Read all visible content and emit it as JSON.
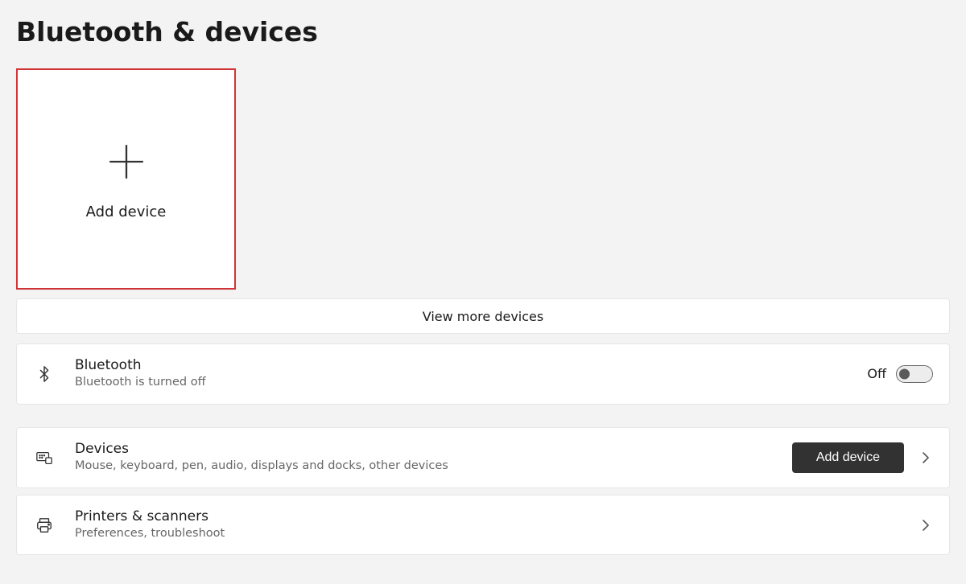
{
  "page": {
    "title": "Bluetooth & devices"
  },
  "addTile": {
    "label": "Add device"
  },
  "viewMore": {
    "label": "View more devices"
  },
  "bluetooth": {
    "title": "Bluetooth",
    "subtitle": "Bluetooth is turned off",
    "stateLabel": "Off"
  },
  "devices": {
    "title": "Devices",
    "subtitle": "Mouse, keyboard, pen, audio, displays and docks, other devices",
    "buttonLabel": "Add device"
  },
  "printers": {
    "title": "Printers & scanners",
    "subtitle": "Preferences, troubleshoot"
  }
}
